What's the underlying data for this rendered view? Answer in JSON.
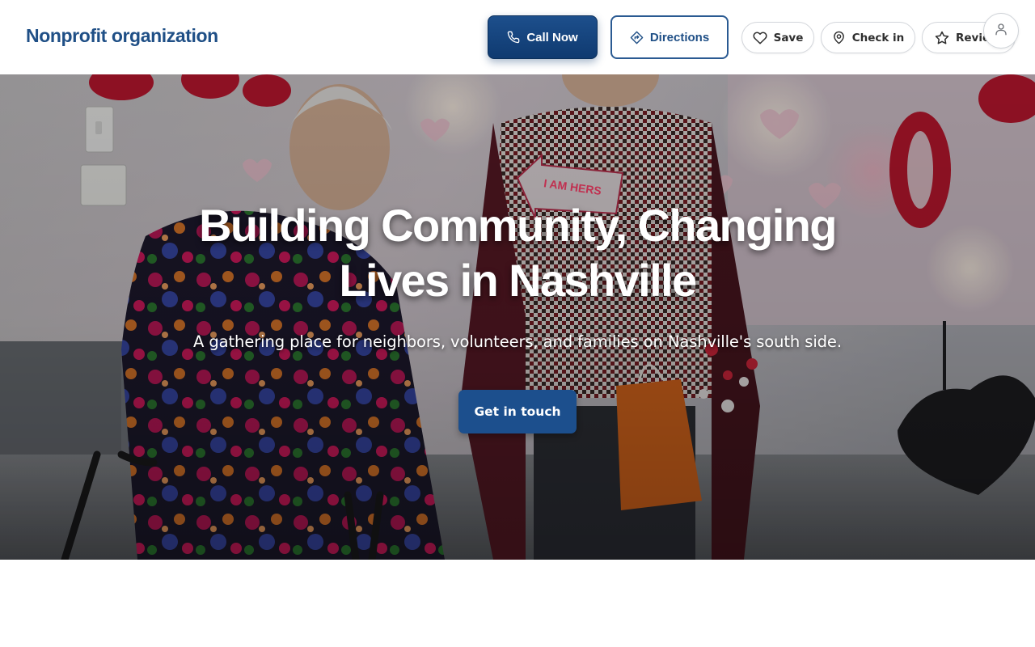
{
  "header": {
    "brand": "Nonprofit organization",
    "call_label": "Call Now",
    "directions_label": "Directions",
    "save_label": "Save",
    "checkin_label": "Check in",
    "review_label": "Review"
  },
  "hero": {
    "title_line1": "Building Community, Changing",
    "title_line2": "Lives in Nashville",
    "subtitle": "A gathering place for neighbors, volunteers, and families on Nashville's south side.",
    "cta_label": "Get in touch",
    "sign_text": "I AM HERS"
  },
  "icons": {
    "call": "phone-icon",
    "directions": "directions-icon",
    "save": "heart-icon",
    "checkin": "map-pin-icon",
    "review": "star-icon",
    "avatar": "user-icon"
  },
  "colors": {
    "brand": "#1f4f86",
    "primary_button": "#1c4f8d",
    "hero_text": "#ffffff"
  }
}
